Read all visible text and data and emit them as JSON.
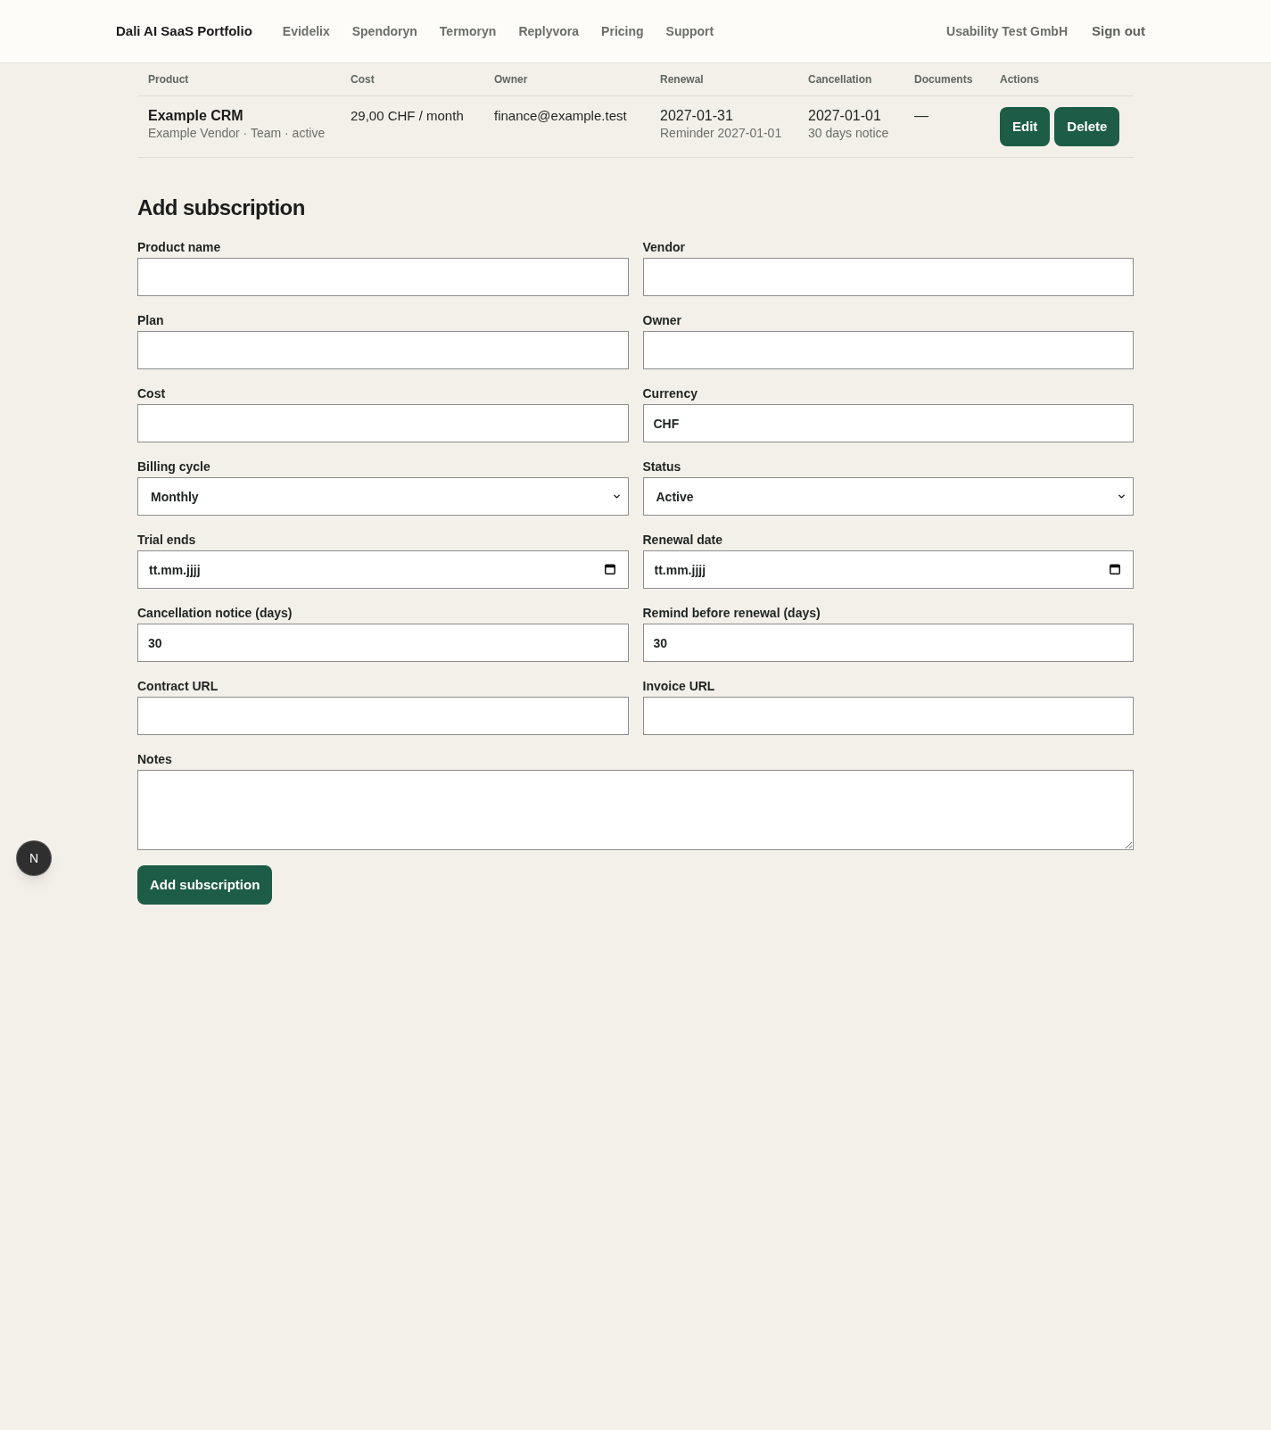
{
  "header": {
    "brand": "Dali AI SaaS Portfolio",
    "nav": [
      "Evidelix",
      "Spendoryn",
      "Termoryn",
      "Replyvora",
      "Pricing",
      "Support"
    ],
    "account": "Usability Test GmbH",
    "sign_out": "Sign out"
  },
  "table": {
    "columns": [
      "Product",
      "Cost",
      "Owner",
      "Renewal",
      "Cancellation",
      "Documents",
      "Actions"
    ],
    "rows": [
      {
        "product": "Example CRM",
        "details": "Example Vendor · Team · active",
        "cost": "29,00 CHF / month",
        "owner": "finance@example.test",
        "renewal": "2027-01-31",
        "reminder": "Reminder 2027-01-01",
        "cancellation": "2027-01-01",
        "notice": "30 days notice",
        "documents": "—",
        "actions": [
          "Edit",
          "Delete"
        ]
      }
    ]
  },
  "form": {
    "title": "Add subscription",
    "fields": [
      {
        "label": "Product name",
        "kind": "text"
      },
      {
        "label": "Vendor",
        "kind": "text"
      },
      {
        "label": "Plan",
        "kind": "text"
      },
      {
        "label": "Owner",
        "kind": "text"
      },
      {
        "label": "Cost",
        "kind": "text"
      },
      {
        "label": "Currency",
        "kind": "text",
        "value": "CHF"
      },
      {
        "label": "Billing cycle",
        "kind": "select",
        "value": "Monthly"
      },
      {
        "label": "Status",
        "kind": "select",
        "value": "Active"
      },
      {
        "label": "Trial ends",
        "kind": "date",
        "placeholder": "tt.mm.jjjj"
      },
      {
        "label": "Renewal date",
        "kind": "date",
        "placeholder": "tt.mm.jjjj"
      },
      {
        "label": "Cancellation notice (days)",
        "kind": "text",
        "value": "30"
      },
      {
        "label": "Remind before renewal (days)",
        "kind": "text",
        "value": "30"
      },
      {
        "label": "Contract URL",
        "kind": "text"
      },
      {
        "label": "Invoice URL",
        "kind": "text"
      },
      {
        "label": "Notes",
        "kind": "textarea"
      }
    ],
    "submit": "Add subscription"
  },
  "floating_badge": {
    "label": "N"
  }
}
